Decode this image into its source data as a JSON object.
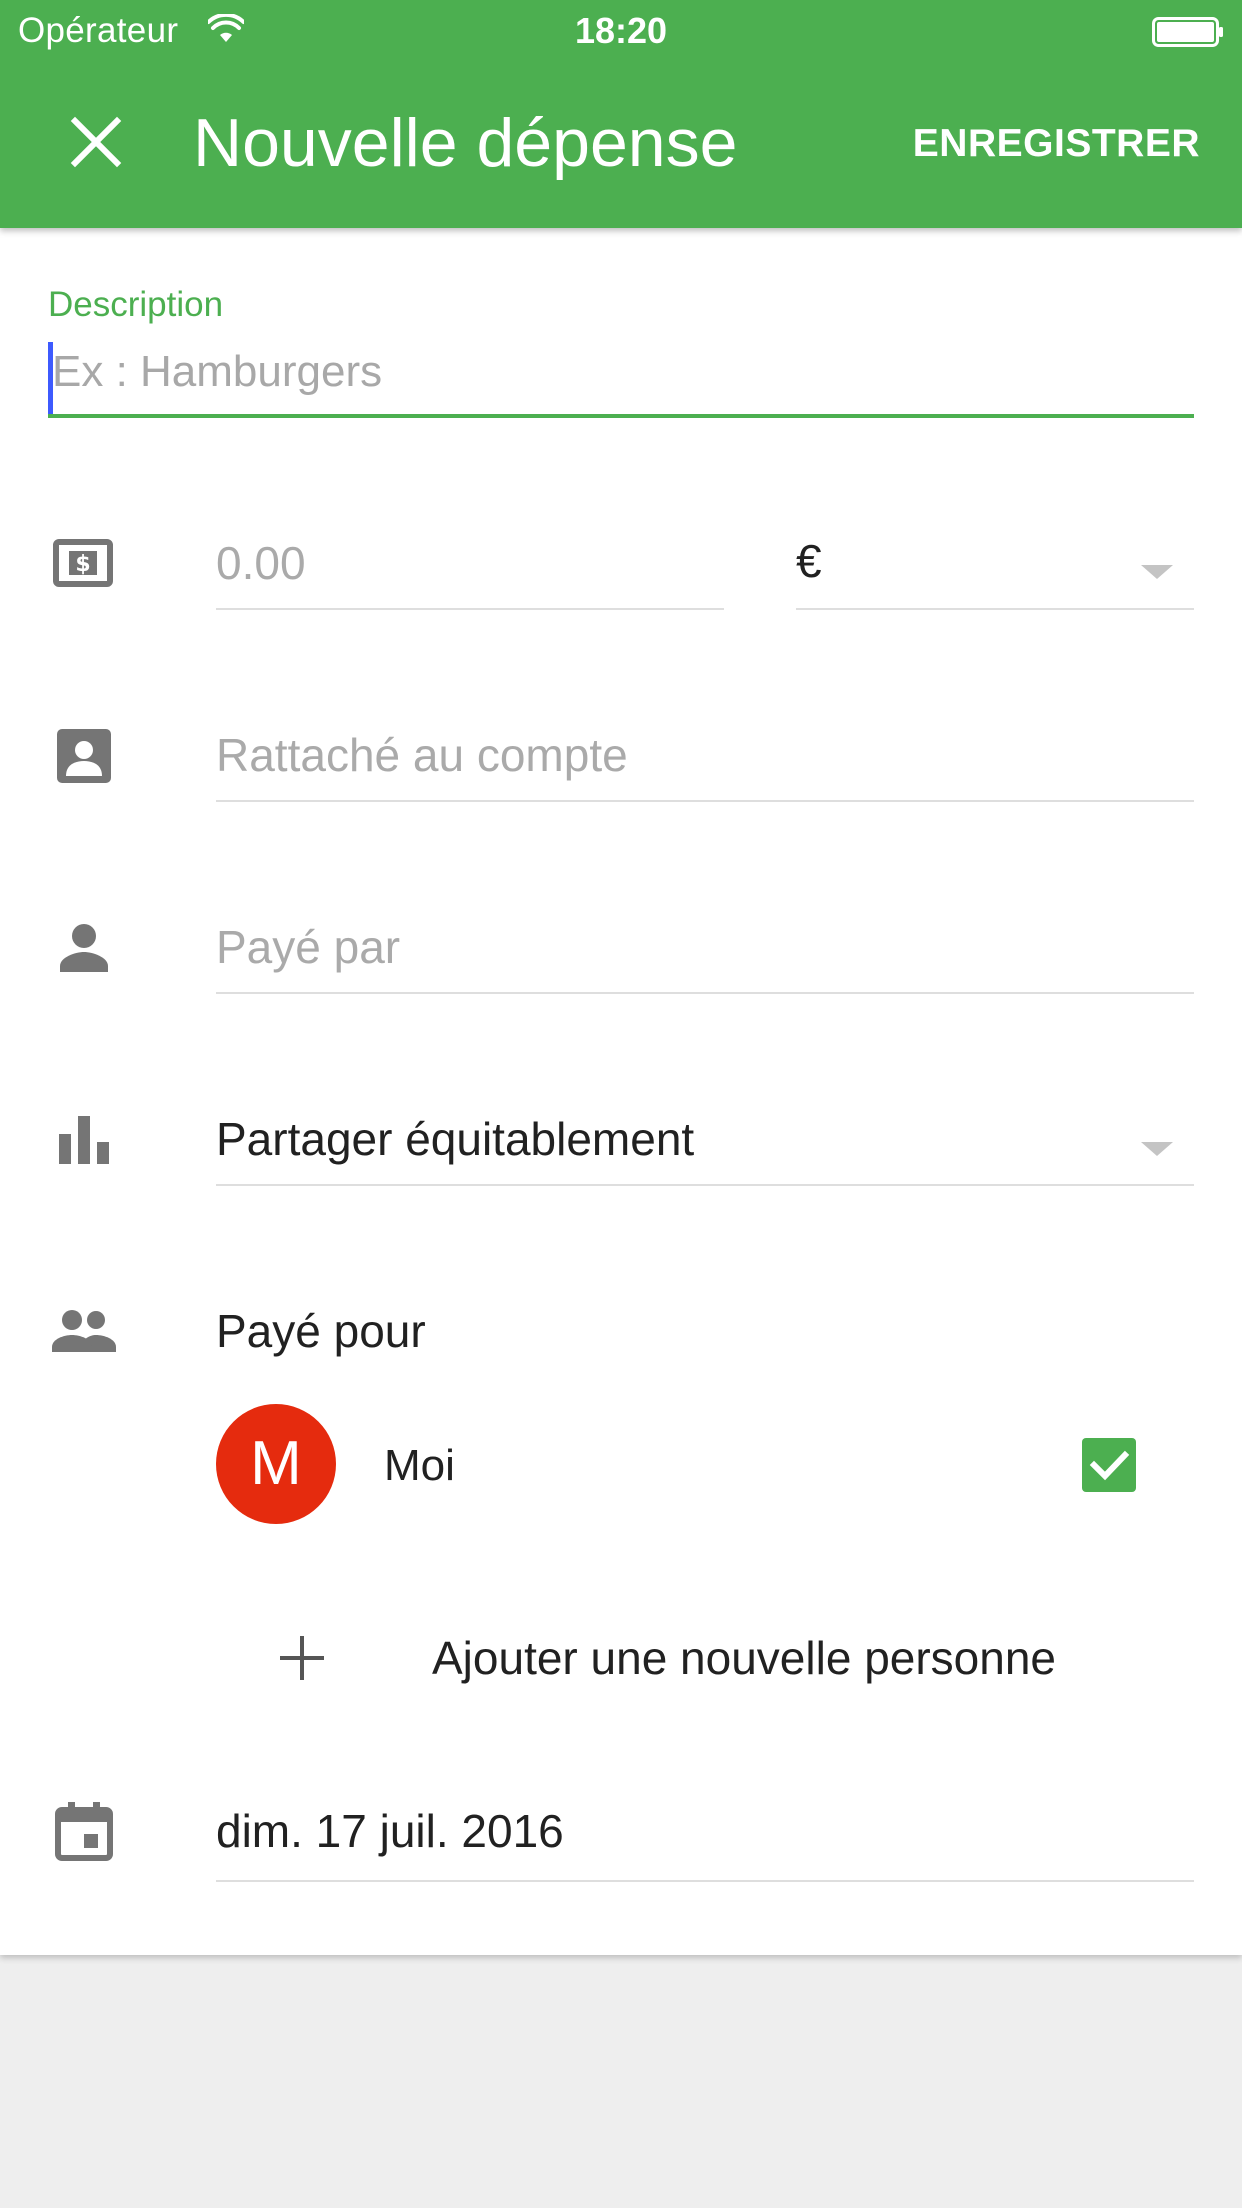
{
  "status_bar": {
    "carrier": "Opérateur",
    "time": "18:20",
    "wifi_icon": "wifi-icon",
    "battery_icon": "battery-icon"
  },
  "header": {
    "close_icon": "close-icon",
    "title": "Nouvelle dépense",
    "save_label": "ENREGISTRER"
  },
  "form": {
    "description": {
      "label": "Description",
      "placeholder": "Ex : Hamburgers",
      "value": ""
    },
    "amount": {
      "icon": "money-icon",
      "placeholder": "0.00",
      "currency": "€"
    },
    "account": {
      "icon": "account-box-icon",
      "placeholder": "Rattaché au compte"
    },
    "paid_by": {
      "icon": "person-icon",
      "placeholder": "Payé par"
    },
    "split": {
      "icon": "bar-chart-icon",
      "value": "Partager équitablement"
    },
    "paid_for": {
      "icon": "group-icon",
      "label": "Payé pour",
      "people": [
        {
          "initial": "M",
          "name": "Moi",
          "checked": true
        }
      ],
      "add_label": "Ajouter une nouvelle personne"
    },
    "date": {
      "icon": "calendar-icon",
      "value": "dim. 17 juil. 2016"
    }
  },
  "colors": {
    "primary": "#4caf50",
    "avatar": "#e52b0e",
    "cursor": "#3d5afe",
    "background": "#eeeeee"
  }
}
